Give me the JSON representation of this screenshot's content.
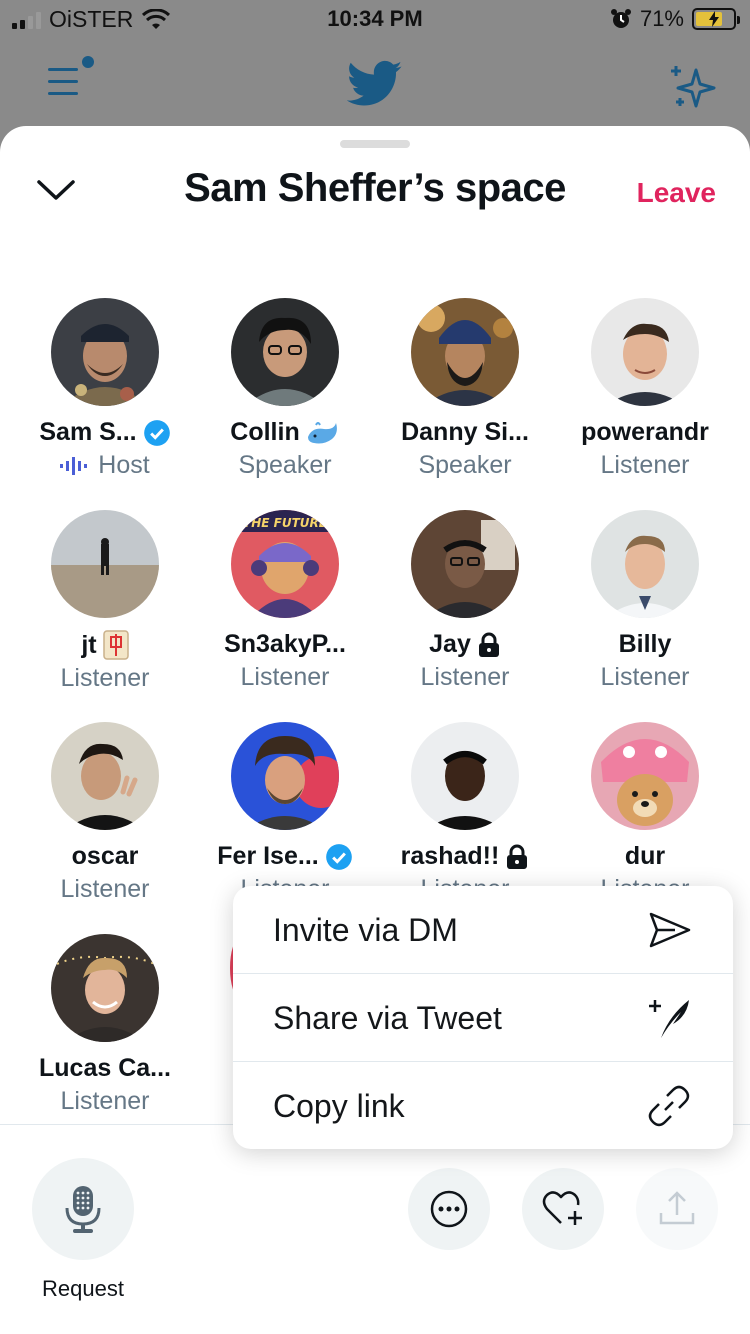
{
  "status_bar": {
    "carrier": "OiSTER",
    "time": "10:34 PM",
    "battery": "71%",
    "battery_level": 0.71
  },
  "header": {
    "icons": [
      "menu-icon",
      "twitter-bird-icon",
      "sparkle-icon"
    ]
  },
  "space": {
    "title": "Sam Sheffer’s space",
    "leave_label": "Leave"
  },
  "participants": [
    {
      "name": "Sam S...",
      "role": "Host",
      "badge": "verified"
    },
    {
      "name": "Collin",
      "role": "Speaker",
      "badge": "whale-emoji"
    },
    {
      "name": "Danny Si...",
      "role": "Speaker"
    },
    {
      "name": "powerandr",
      "role": "Listener"
    },
    {
      "name": "jt",
      "role": "Listener",
      "badge": "mahjong-emoji"
    },
    {
      "name": "Sn3akyP...",
      "role": "Listener"
    },
    {
      "name": "Jay",
      "role": "Listener",
      "badge": "lock"
    },
    {
      "name": "Billy",
      "role": "Listener"
    },
    {
      "name": "oscar",
      "role": "Listener"
    },
    {
      "name": "Fer Ise...",
      "role": "Listener",
      "badge": "verified"
    },
    {
      "name": "rashad!!",
      "role": "Listener",
      "badge": "lock"
    },
    {
      "name": "dur",
      "role": "Listener"
    },
    {
      "name": "Lucas Ca...",
      "role": "Listener"
    }
  ],
  "menu": {
    "items": [
      {
        "label": "Invite via DM",
        "icon": "send-icon"
      },
      {
        "label": "Share via Tweet",
        "icon": "compose-tweet-icon"
      },
      {
        "label": "Copy link",
        "icon": "link-icon"
      }
    ]
  },
  "bottom_bar": {
    "request_label": "Request",
    "icons": [
      "microphone-icon",
      "more-icon",
      "heart-plus-icon",
      "share-icon"
    ]
  },
  "colors": {
    "accent": "#1da1f2",
    "leave": "#e0245e",
    "muted": "#657786"
  }
}
